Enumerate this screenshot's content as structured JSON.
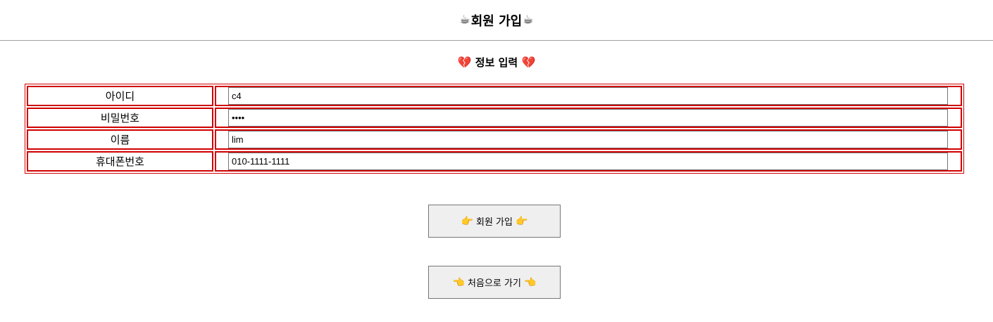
{
  "header": {
    "title": "회원 가입",
    "left_emoji": "☕",
    "right_emoji": "☕"
  },
  "section": {
    "title": "정보 입력",
    "left_emoji": "💔",
    "right_emoji": "💔"
  },
  "form": {
    "rows": [
      {
        "label": "아이디",
        "value": "c4",
        "type": "text"
      },
      {
        "label": "비밀번호",
        "value": "1234",
        "type": "password"
      },
      {
        "label": "이름",
        "value": "lim",
        "type": "text"
      },
      {
        "label": "휴대폰번호",
        "value": "010-1111-1111",
        "type": "text"
      }
    ]
  },
  "buttons": {
    "signup": {
      "label": "회원 가입",
      "emoji": "👉"
    },
    "home": {
      "label": "처음으로 가기",
      "emoji": "👈"
    }
  },
  "colors": {
    "table_border": "#d00000",
    "button_bg": "#efefef",
    "divider": "#a0a0a0"
  }
}
